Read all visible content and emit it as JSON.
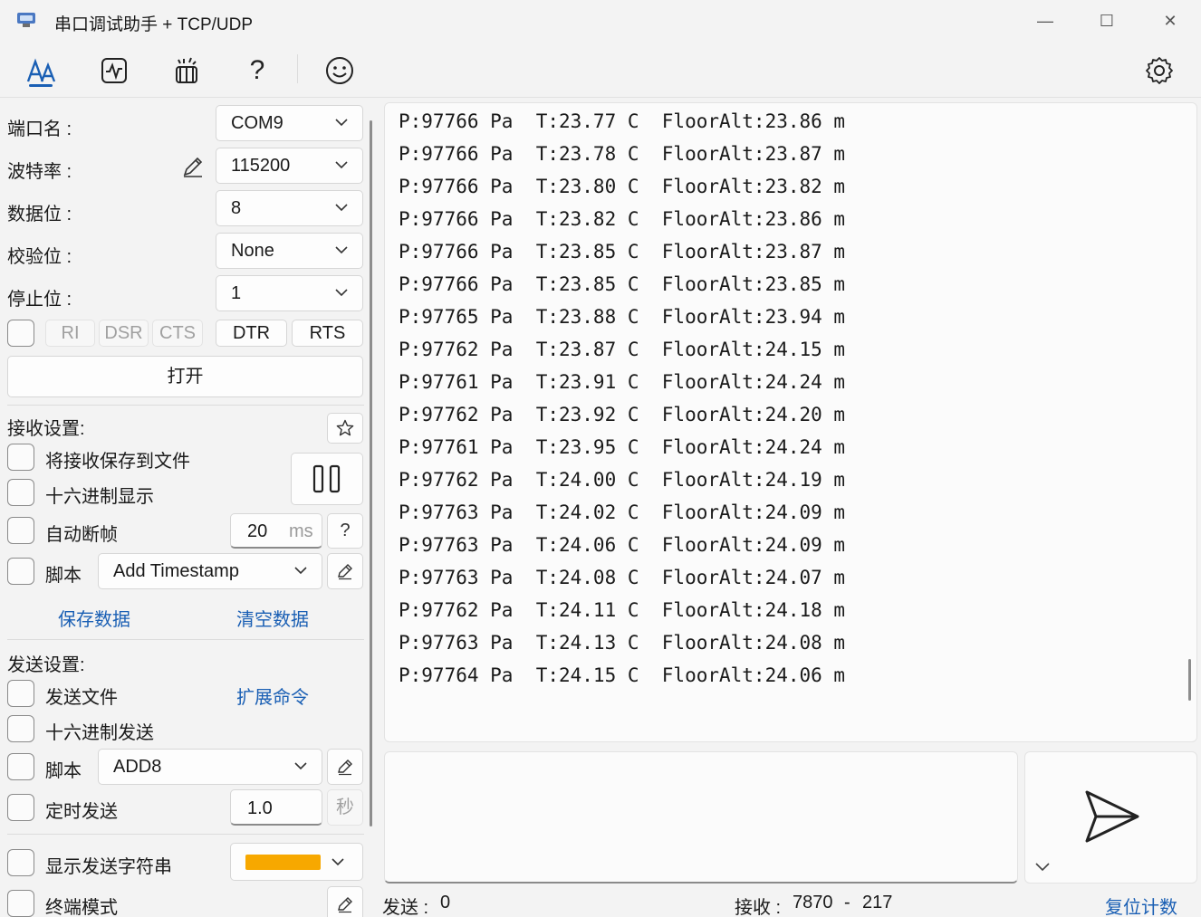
{
  "window": {
    "title": "串口调试助手 + TCP/UDP",
    "minimize": "—",
    "maximize": "☐",
    "close": "✕"
  },
  "toolbar": {
    "icons": [
      "text-receive-icon",
      "waveform-icon",
      "clean-icon",
      "help-icon",
      "smiley-icon",
      "settings-icon"
    ],
    "help_label": "?"
  },
  "serial": {
    "port_label": "端口名 :",
    "port_value": "COM9",
    "baud_label": "波特率 :",
    "baud_value": "115200",
    "databits_label": "数据位 :",
    "databits_value": "8",
    "parity_label": "校验位 :",
    "parity_value": "None",
    "stopbits_label": "停止位 :",
    "stopbits_value": "1",
    "ri": "RI",
    "dsr": "DSR",
    "cts": "CTS",
    "dtr": "DTR",
    "rts": "RTS",
    "open_button": "打开"
  },
  "receive_settings": {
    "heading": "接收设置:",
    "save_to_file": "将接收保存到文件",
    "hex_display": "十六进制显示",
    "auto_frame": "自动断帧",
    "frame_ms_value": "20",
    "frame_ms_unit": "ms",
    "frame_help": "?",
    "script_label": "脚本",
    "script_value": "Add Timestamp",
    "save_data": "保存数据",
    "clear_data": "清空数据"
  },
  "send_settings": {
    "heading": "发送设置:",
    "send_file": "发送文件",
    "extend_cmd": "扩展命令",
    "hex_send": "十六进制发送",
    "script_label": "脚本",
    "script_value": "ADD8",
    "timed_send": "定时发送",
    "timed_value": "1.0",
    "timed_unit": "秒",
    "show_send_string": "显示发送字符串",
    "show_send_color": "#f7a800",
    "terminal_mode": "终端模式"
  },
  "receive_lines": [
    "P:97766 Pa  T:23.77 C  FloorAlt:23.86 m",
    "P:97766 Pa  T:23.78 C  FloorAlt:23.87 m",
    "P:97766 Pa  T:23.80 C  FloorAlt:23.82 m",
    "P:97766 Pa  T:23.82 C  FloorAlt:23.86 m",
    "P:97766 Pa  T:23.85 C  FloorAlt:23.87 m",
    "P:97766 Pa  T:23.85 C  FloorAlt:23.85 m",
    "P:97765 Pa  T:23.88 C  FloorAlt:23.94 m",
    "P:97762 Pa  T:23.87 C  FloorAlt:24.15 m",
    "P:97761 Pa  T:23.91 C  FloorAlt:24.24 m",
    "P:97762 Pa  T:23.92 C  FloorAlt:24.20 m",
    "P:97761 Pa  T:23.95 C  FloorAlt:24.24 m",
    "P:97762 Pa  T:24.00 C  FloorAlt:24.19 m",
    "P:97763 Pa  T:24.02 C  FloorAlt:24.09 m",
    "P:97763 Pa  T:24.06 C  FloorAlt:24.09 m",
    "P:97763 Pa  T:24.08 C  FloorAlt:24.07 m",
    "P:97762 Pa  T:24.11 C  FloorAlt:24.18 m",
    "P:97763 Pa  T:24.13 C  FloorAlt:24.08 m",
    "P:97764 Pa  T:24.15 C  FloorAlt:24.06 m"
  ],
  "status": {
    "send_label": "发送 :",
    "send_count": "0",
    "recv_label": "接收 :",
    "recv_count": "7870",
    "recv_sep": "-",
    "recv_lines": "217",
    "reset_count": "复位计数"
  },
  "colors": {
    "accent": "#1a5fb4",
    "swatch": "#f7a800"
  }
}
